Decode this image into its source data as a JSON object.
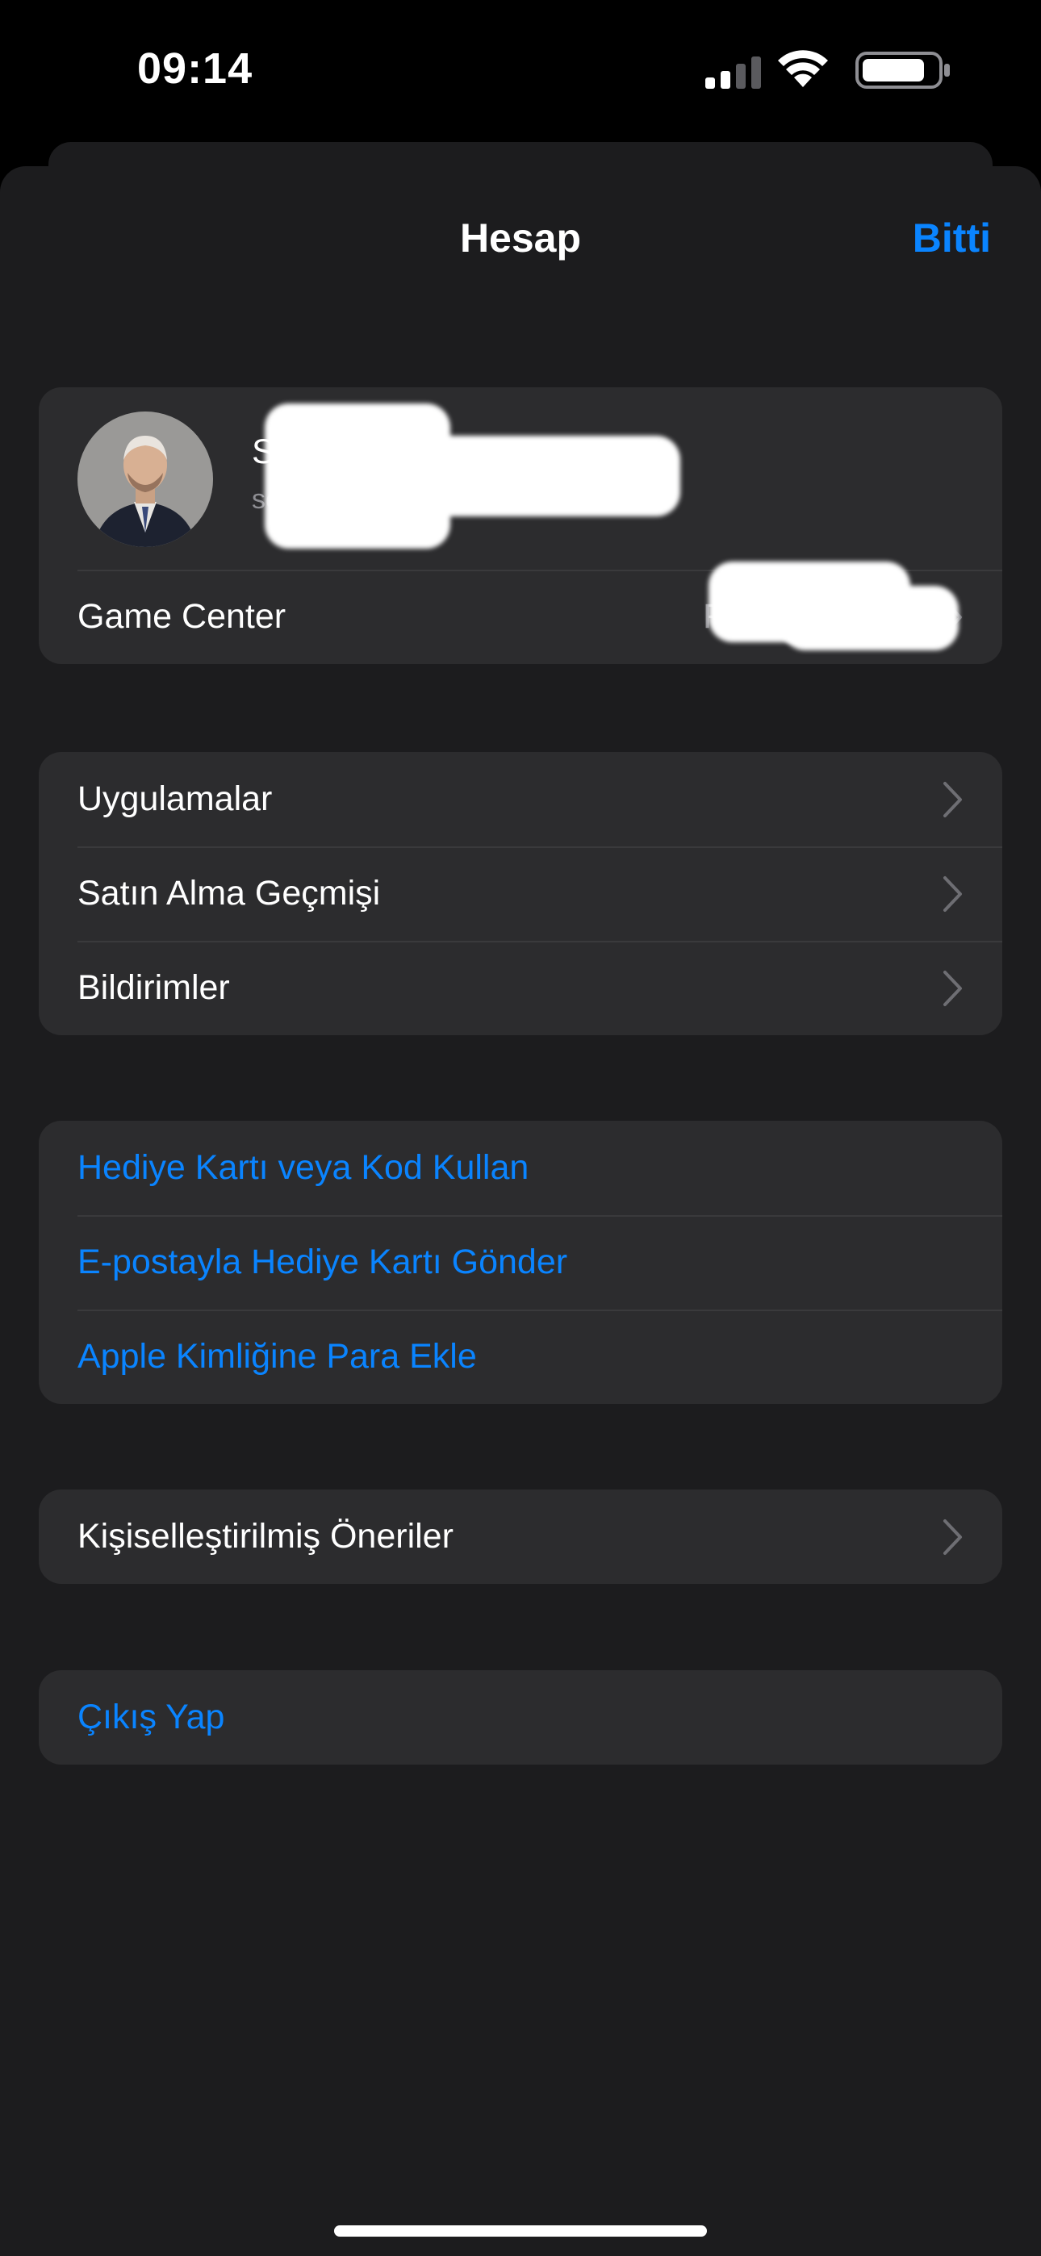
{
  "status_bar": {
    "time": "09:14",
    "icons": [
      "cellular-signal-icon",
      "wifi-icon",
      "battery-icon"
    ]
  },
  "nav": {
    "title": "Hesap",
    "done_label": "Bitti"
  },
  "profile": {
    "name": "S",
    "email": "se",
    "game_center_label": "Game Center",
    "game_center_value": "R"
  },
  "menu_group": {
    "items": [
      {
        "label": "Uygulamalar"
      },
      {
        "label": "Satın Alma Geçmişi"
      },
      {
        "label": "Bildirimler"
      }
    ]
  },
  "gift_group": {
    "items": [
      {
        "label": "Hediye Kartı veya Kod Kullan"
      },
      {
        "label": "E-postayla Hediye Kartı Gönder"
      },
      {
        "label": "Apple Kimliğine Para Ekle"
      }
    ]
  },
  "recommendations": {
    "label": "Kişiselleştirilmiş Öneriler"
  },
  "signout": {
    "label": "Çıkış Yap"
  },
  "colors": {
    "accent": "#0a84ff",
    "background": "#1c1c1e",
    "cell": "#2c2c2e",
    "secondary_text": "#8e8e93"
  }
}
